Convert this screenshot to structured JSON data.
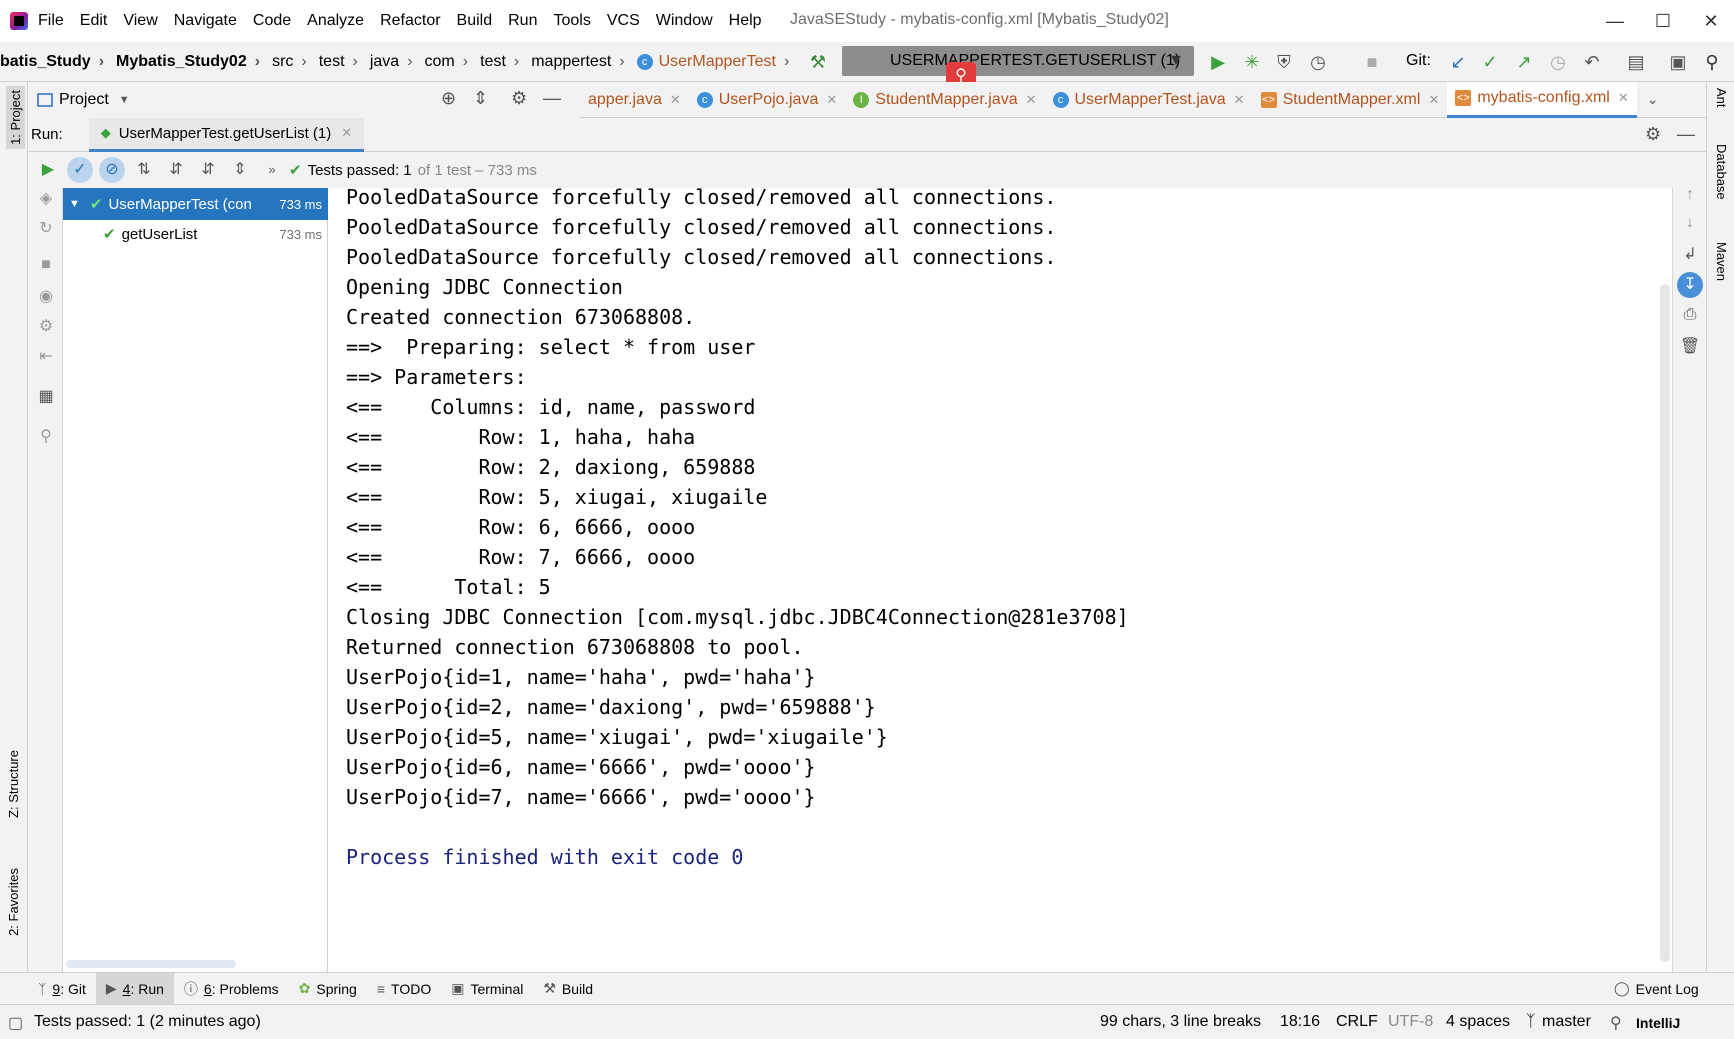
{
  "window": {
    "title": "JavaSEStudy - mybatis-config.xml [Mybatis_Study02]",
    "menu": [
      "File",
      "Edit",
      "View",
      "Navigate",
      "Code",
      "Analyze",
      "Refactor",
      "Build",
      "Run",
      "Tools",
      "VCS",
      "Window",
      "Help"
    ]
  },
  "breadcrumb": [
    "batis_Study",
    "Mybatis_Study02",
    "src",
    "test",
    "java",
    "com",
    "test",
    "mappertest",
    "UserMapperTest"
  ],
  "run_config": "USERMAPPERTEST.GETUSERLIST (1)",
  "git_label": "Git:",
  "project_panel": {
    "title": "Project"
  },
  "editor_tabs": [
    {
      "label": "apper.java",
      "icon": "class-icon",
      "color": "#3c8fd9"
    },
    {
      "label": "UserPojo.java",
      "icon": "class-icon",
      "color": "#3c8fd9"
    },
    {
      "label": "StudentMapper.java",
      "icon": "interface-icon",
      "color": "#6cb346"
    },
    {
      "label": "UserMapperTest.java",
      "icon": "class-icon",
      "color": "#3c8fd9"
    },
    {
      "label": "StudentMapper.xml",
      "icon": "xml-icon",
      "color": "#e08a3c"
    },
    {
      "label": "mybatis-config.xml",
      "icon": "xml-icon",
      "color": "#e08a3c"
    }
  ],
  "run_panel": {
    "label": "Run:",
    "tab": "UserMapperTest.getUserList (1)",
    "tests_status": "Tests passed:",
    "tests_count": "1",
    "tests_detail": "of 1 test – 733 ms",
    "tree": [
      {
        "label": "UserMapperTest (con",
        "time": "733 ms",
        "selected": true
      },
      {
        "label": "getUserList",
        "time": "733 ms",
        "selected": false
      }
    ]
  },
  "console": [
    "PooledDataSource forcefully closed/removed all connections.",
    "PooledDataSource forcefully closed/removed all connections.",
    "PooledDataSource forcefully closed/removed all connections.",
    "Opening JDBC Connection",
    "Created connection 673068808.",
    "==>  Preparing: select * from user",
    "==> Parameters: ",
    "<==    Columns: id, name, password",
    "<==        Row: 1, haha, haha",
    "<==        Row: 2, daxiong, 659888",
    "<==        Row: 5, xiugai, xiugaile",
    "<==        Row: 6, 6666, oooo",
    "<==        Row: 7, 6666, oooo",
    "<==      Total: 5",
    "Closing JDBC Connection [com.mysql.jdbc.JDBC4Connection@281e3708]",
    "Returned connection 673068808 to pool.",
    "UserPojo{id=1, name='haha', pwd='haha'}",
    "UserPojo{id=2, name='daxiong', pwd='659888'}",
    "UserPojo{id=5, name='xiugai', pwd='xiugaile'}",
    "UserPojo{id=6, name='6666', pwd='oooo'}",
    "UserPojo{id=7, name='6666', pwd='oooo'}",
    "",
    "Process finished with exit code 0"
  ],
  "side_left": [
    "1: Project",
    "Z: Structure",
    "2: Favorites"
  ],
  "side_right": [
    "Ant",
    "Database",
    "Maven"
  ],
  "bottom_tabs": [
    {
      "key": "9",
      "label": ": Git"
    },
    {
      "key": "4",
      "label": ": Run"
    },
    {
      "key": "6",
      "label": ": Problems"
    },
    {
      "key": "",
      "label": "Spring"
    },
    {
      "key": "",
      "label": "TODO"
    },
    {
      "key": "",
      "label": "Terminal"
    },
    {
      "key": "",
      "label": "Build"
    }
  ],
  "event_log": "Event Log",
  "status": {
    "message": "Tests passed: 1 (2 minutes ago)",
    "chars": "99 chars, 3 line breaks",
    "position": "18:16",
    "line_sep": "CRLF",
    "encoding": "UTF-8",
    "indent": "4 spaces",
    "branch": "master",
    "app": "IntelliJ"
  },
  "colors": {
    "selected": "#2675bf",
    "accent": "#4083c9",
    "pass": "#59a869",
    "exit_text": "#1a237e"
  }
}
